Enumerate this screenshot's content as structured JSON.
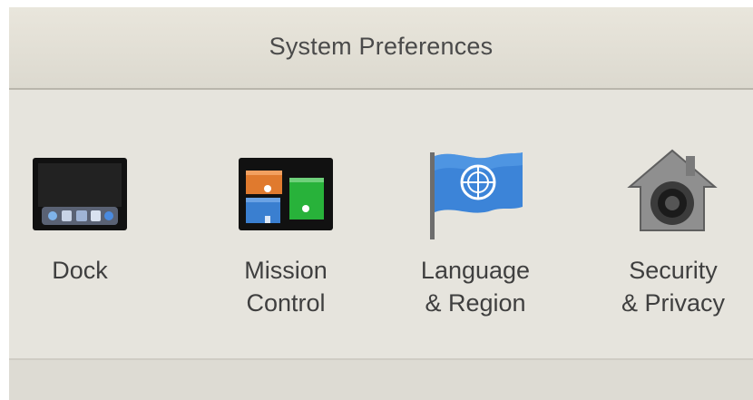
{
  "window": {
    "title": "System Preferences"
  },
  "preferences": [
    {
      "name": "dock",
      "label": "Dock",
      "icon": "dock-icon"
    },
    {
      "name": "mission-control",
      "label": "Mission\nControl",
      "icon": "mission-control-icon"
    },
    {
      "name": "language-region",
      "label": "Language\n& Region",
      "icon": "un-flag-icon"
    },
    {
      "name": "security-privacy",
      "label": "Security\n& Privacy",
      "icon": "security-house-icon"
    }
  ]
}
